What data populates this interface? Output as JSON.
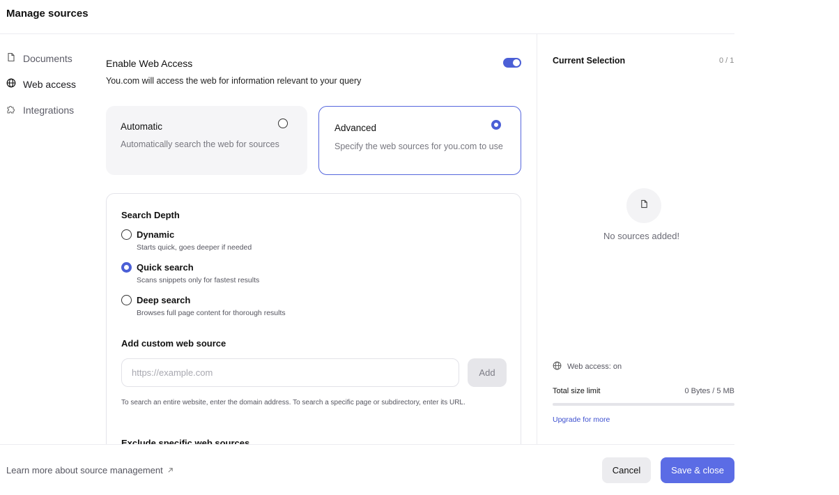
{
  "header": {
    "title": "Manage sources"
  },
  "sidebar": {
    "items": [
      {
        "label": "Documents",
        "icon": "document-icon"
      },
      {
        "label": "Web access",
        "icon": "globe-icon",
        "active": true
      },
      {
        "label": "Integrations",
        "icon": "puzzle-icon"
      }
    ]
  },
  "web_access": {
    "title": "Enable Web Access",
    "description": "You.com will access the web for information relevant to your query",
    "enabled": true,
    "modes": [
      {
        "title": "Automatic",
        "description": "Automatically search the web for sources",
        "selected": false
      },
      {
        "title": "Advanced",
        "description": "Specify the web sources for you.com to use",
        "selected": true
      }
    ]
  },
  "advanced": {
    "search_depth_title": "Search Depth",
    "depth_options": [
      {
        "label": "Dynamic",
        "sub": "Starts quick, goes deeper if needed",
        "selected": false
      },
      {
        "label": "Quick search",
        "sub": "Scans snippets only for fastest results",
        "selected": true
      },
      {
        "label": "Deep search",
        "sub": "Browses full page content for thorough results",
        "selected": false
      }
    ],
    "custom_source_title": "Add custom web source",
    "input_value": "",
    "input_placeholder": "https://example.com",
    "add_label": "Add",
    "help_text": "To search an entire website, enter the domain address. To search a specific page or subdirectory, enter its URL.",
    "exclude_title": "Exclude specific web sources"
  },
  "selection": {
    "title": "Current Selection",
    "count": "0 / 1",
    "empty_text": "No sources added!",
    "web_access_status": "Web access: on",
    "size_label": "Total size limit",
    "size_value": "0 Bytes / 5 MB",
    "size_used_fraction": 0,
    "upgrade_label": "Upgrade for more"
  },
  "footer": {
    "learn_more": "Learn more about source management",
    "learn_more_icon": "arrow-up-right-icon",
    "cancel_label": "Cancel",
    "save_label": "Save & close"
  },
  "colors": {
    "accent": "#4b5fd6",
    "button_primary": "#5b6ce5"
  }
}
